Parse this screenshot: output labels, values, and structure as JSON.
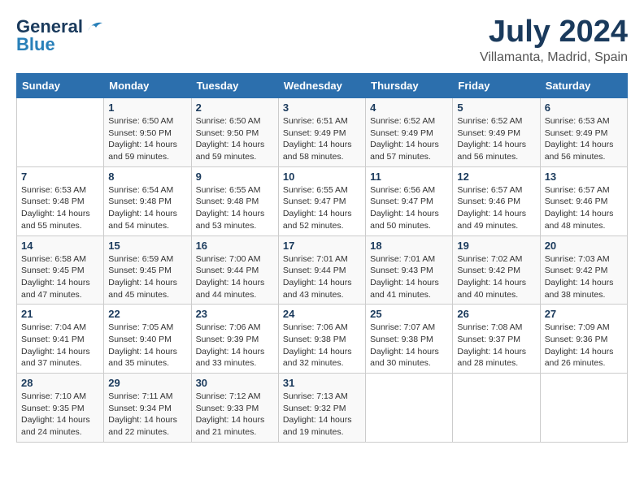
{
  "logo": {
    "line1": "General",
    "line2": "Blue"
  },
  "title": {
    "month_year": "July 2024",
    "location": "Villamanta, Madrid, Spain"
  },
  "days_of_week": [
    "Sunday",
    "Monday",
    "Tuesday",
    "Wednesday",
    "Thursday",
    "Friday",
    "Saturday"
  ],
  "weeks": [
    [
      {
        "day": "",
        "info": ""
      },
      {
        "day": "1",
        "info": "Sunrise: 6:50 AM\nSunset: 9:50 PM\nDaylight: 14 hours\nand 59 minutes."
      },
      {
        "day": "2",
        "info": "Sunrise: 6:50 AM\nSunset: 9:50 PM\nDaylight: 14 hours\nand 59 minutes."
      },
      {
        "day": "3",
        "info": "Sunrise: 6:51 AM\nSunset: 9:49 PM\nDaylight: 14 hours\nand 58 minutes."
      },
      {
        "day": "4",
        "info": "Sunrise: 6:52 AM\nSunset: 9:49 PM\nDaylight: 14 hours\nand 57 minutes."
      },
      {
        "day": "5",
        "info": "Sunrise: 6:52 AM\nSunset: 9:49 PM\nDaylight: 14 hours\nand 56 minutes."
      },
      {
        "day": "6",
        "info": "Sunrise: 6:53 AM\nSunset: 9:49 PM\nDaylight: 14 hours\nand 56 minutes."
      }
    ],
    [
      {
        "day": "7",
        "info": "Sunrise: 6:53 AM\nSunset: 9:48 PM\nDaylight: 14 hours\nand 55 minutes."
      },
      {
        "day": "8",
        "info": "Sunrise: 6:54 AM\nSunset: 9:48 PM\nDaylight: 14 hours\nand 54 minutes."
      },
      {
        "day": "9",
        "info": "Sunrise: 6:55 AM\nSunset: 9:48 PM\nDaylight: 14 hours\nand 53 minutes."
      },
      {
        "day": "10",
        "info": "Sunrise: 6:55 AM\nSunset: 9:47 PM\nDaylight: 14 hours\nand 52 minutes."
      },
      {
        "day": "11",
        "info": "Sunrise: 6:56 AM\nSunset: 9:47 PM\nDaylight: 14 hours\nand 50 minutes."
      },
      {
        "day": "12",
        "info": "Sunrise: 6:57 AM\nSunset: 9:46 PM\nDaylight: 14 hours\nand 49 minutes."
      },
      {
        "day": "13",
        "info": "Sunrise: 6:57 AM\nSunset: 9:46 PM\nDaylight: 14 hours\nand 48 minutes."
      }
    ],
    [
      {
        "day": "14",
        "info": "Sunrise: 6:58 AM\nSunset: 9:45 PM\nDaylight: 14 hours\nand 47 minutes."
      },
      {
        "day": "15",
        "info": "Sunrise: 6:59 AM\nSunset: 9:45 PM\nDaylight: 14 hours\nand 45 minutes."
      },
      {
        "day": "16",
        "info": "Sunrise: 7:00 AM\nSunset: 9:44 PM\nDaylight: 14 hours\nand 44 minutes."
      },
      {
        "day": "17",
        "info": "Sunrise: 7:01 AM\nSunset: 9:44 PM\nDaylight: 14 hours\nand 43 minutes."
      },
      {
        "day": "18",
        "info": "Sunrise: 7:01 AM\nSunset: 9:43 PM\nDaylight: 14 hours\nand 41 minutes."
      },
      {
        "day": "19",
        "info": "Sunrise: 7:02 AM\nSunset: 9:42 PM\nDaylight: 14 hours\nand 40 minutes."
      },
      {
        "day": "20",
        "info": "Sunrise: 7:03 AM\nSunset: 9:42 PM\nDaylight: 14 hours\nand 38 minutes."
      }
    ],
    [
      {
        "day": "21",
        "info": "Sunrise: 7:04 AM\nSunset: 9:41 PM\nDaylight: 14 hours\nand 37 minutes."
      },
      {
        "day": "22",
        "info": "Sunrise: 7:05 AM\nSunset: 9:40 PM\nDaylight: 14 hours\nand 35 minutes."
      },
      {
        "day": "23",
        "info": "Sunrise: 7:06 AM\nSunset: 9:39 PM\nDaylight: 14 hours\nand 33 minutes."
      },
      {
        "day": "24",
        "info": "Sunrise: 7:06 AM\nSunset: 9:38 PM\nDaylight: 14 hours\nand 32 minutes."
      },
      {
        "day": "25",
        "info": "Sunrise: 7:07 AM\nSunset: 9:38 PM\nDaylight: 14 hours\nand 30 minutes."
      },
      {
        "day": "26",
        "info": "Sunrise: 7:08 AM\nSunset: 9:37 PM\nDaylight: 14 hours\nand 28 minutes."
      },
      {
        "day": "27",
        "info": "Sunrise: 7:09 AM\nSunset: 9:36 PM\nDaylight: 14 hours\nand 26 minutes."
      }
    ],
    [
      {
        "day": "28",
        "info": "Sunrise: 7:10 AM\nSunset: 9:35 PM\nDaylight: 14 hours\nand 24 minutes."
      },
      {
        "day": "29",
        "info": "Sunrise: 7:11 AM\nSunset: 9:34 PM\nDaylight: 14 hours\nand 22 minutes."
      },
      {
        "day": "30",
        "info": "Sunrise: 7:12 AM\nSunset: 9:33 PM\nDaylight: 14 hours\nand 21 minutes."
      },
      {
        "day": "31",
        "info": "Sunrise: 7:13 AM\nSunset: 9:32 PM\nDaylight: 14 hours\nand 19 minutes."
      },
      {
        "day": "",
        "info": ""
      },
      {
        "day": "",
        "info": ""
      },
      {
        "day": "",
        "info": ""
      }
    ]
  ]
}
